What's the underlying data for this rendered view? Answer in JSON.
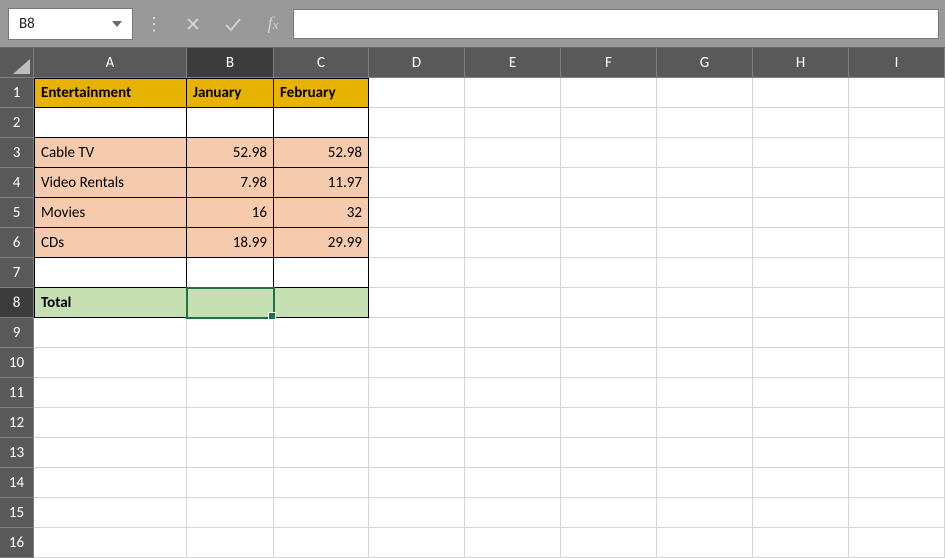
{
  "nameBox": {
    "value": "B8"
  },
  "formulaBar": {
    "value": ""
  },
  "columns": [
    "A",
    "B",
    "C",
    "D",
    "E",
    "F",
    "G",
    "H",
    "I"
  ],
  "rowCount": 16,
  "activeColumn": "B",
  "activeRow": 8,
  "selection": {
    "col": "B",
    "row": 8
  },
  "header": {
    "A": "Entertainment",
    "B": "January",
    "C": "February"
  },
  "dataRows": [
    {
      "A": "Cable TV",
      "B": "52.98",
      "C": "52.98"
    },
    {
      "A": "Video Rentals",
      "B": "7.98",
      "C": "11.97"
    },
    {
      "A": "Movies",
      "B": "16",
      "C": "32"
    },
    {
      "A": "CDs",
      "B": "18.99",
      "C": "29.99"
    }
  ],
  "totalRow": {
    "A": "Total",
    "B": "",
    "C": ""
  },
  "chart_data": {
    "type": "table",
    "title": "Entertainment",
    "columns": [
      "January",
      "February"
    ],
    "rows": [
      "Cable TV",
      "Video Rentals",
      "Movies",
      "CDs"
    ],
    "values": [
      [
        52.98,
        52.98
      ],
      [
        7.98,
        11.97
      ],
      [
        16,
        32
      ],
      [
        18.99,
        29.99
      ]
    ],
    "total_row_label": "Total"
  }
}
